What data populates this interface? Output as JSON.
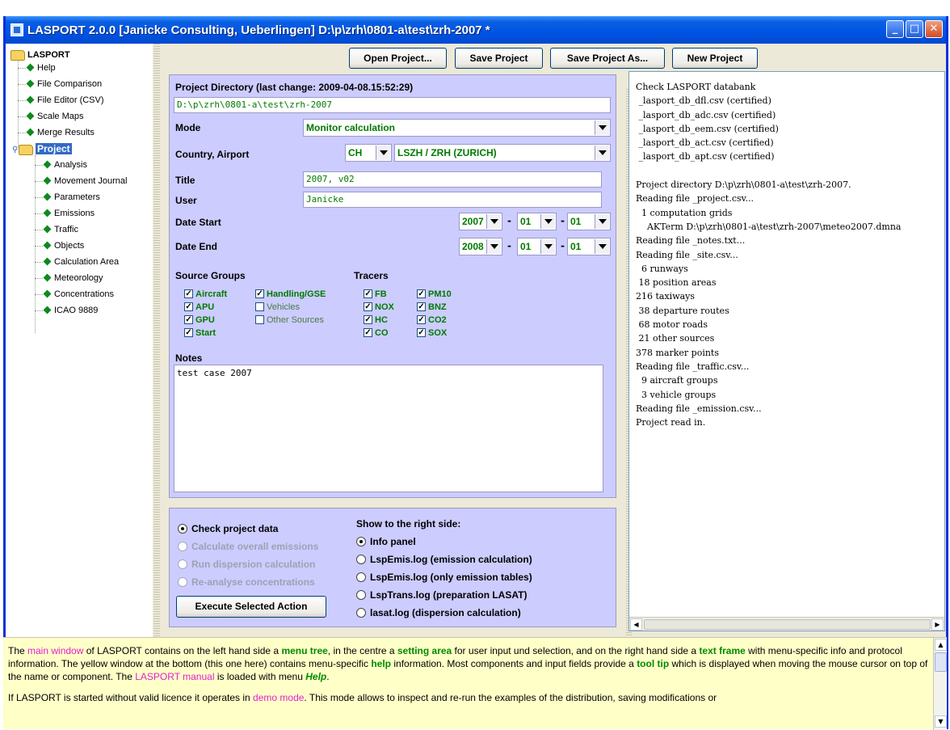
{
  "window": {
    "title": "LASPORT 2.0.0 [Janicke Consulting, Ueberlingen] D:\\p\\zrh\\0801-a\\test\\zrh-2007 *"
  },
  "tree": {
    "root": "LASPORT",
    "items": [
      "Help",
      "File Comparison",
      "File Editor (CSV)",
      "Scale Maps",
      "Merge Results"
    ],
    "project": "Project",
    "project_items": [
      "Analysis",
      "Movement Journal",
      "Parameters",
      "Emissions",
      "Traffic",
      "Objects",
      "Calculation Area",
      "Meteorology",
      "Concentrations",
      "ICAO 9889"
    ]
  },
  "toolbar": {
    "open": "Open Project...",
    "save": "Save Project",
    "save_as": "Save Project As...",
    "new": "New Project"
  },
  "project": {
    "dir_label": "Project Directory (last change: 2009-04-08.15:52:29)",
    "dir_value": "D:\\p\\zrh\\0801-a\\test\\zrh-2007",
    "mode_label": "Mode",
    "mode_value": "Monitor calculation",
    "country_label": "Country, Airport",
    "country_value": "CH",
    "airport_value": "LSZH / ZRH (ZURICH)",
    "title_label": "Title",
    "title_value": "2007, v02",
    "user_label": "User",
    "user_value": "Janicke",
    "date_start_label": "Date Start",
    "date_start": {
      "year": "2007",
      "month": "01",
      "day": "01"
    },
    "date_end_label": "Date End",
    "date_end": {
      "year": "2008",
      "month": "01",
      "day": "01"
    },
    "date_sep": "-",
    "source_groups_label": "Source Groups",
    "tracers_label": "Tracers",
    "source_groups": [
      {
        "label": "Aircraft",
        "checked": true
      },
      {
        "label": "APU",
        "checked": true
      },
      {
        "label": "GPU",
        "checked": true
      },
      {
        "label": "Start",
        "checked": true
      },
      {
        "label": "Handling/GSE",
        "checked": true
      },
      {
        "label": "Vehicles",
        "checked": false
      },
      {
        "label": "Other Sources",
        "checked": false
      }
    ],
    "tracers": [
      {
        "label": "FB",
        "checked": true
      },
      {
        "label": "NOX",
        "checked": true
      },
      {
        "label": "HC",
        "checked": true
      },
      {
        "label": "CO",
        "checked": true
      },
      {
        "label": "PM10",
        "checked": true
      },
      {
        "label": "BNZ",
        "checked": true
      },
      {
        "label": "CO2",
        "checked": true
      },
      {
        "label": "SOX",
        "checked": true
      }
    ],
    "notes_label": "Notes",
    "notes_value": "test case 2007"
  },
  "actions": {
    "items": [
      "Check project data",
      "Calculate overall emissions",
      "Run dispersion calculation",
      "Re-analyse concentrations"
    ],
    "selected": 0,
    "execute": "Execute Selected Action",
    "show_label": "Show to the right side:",
    "show_items": [
      "Info panel",
      "LspEmis.log (emission calculation)",
      "LspEmis.log (only emission tables)",
      "LspTrans.log (preparation LASAT)",
      "lasat.log (dispersion calculation)"
    ],
    "show_selected": 0
  },
  "info_lines": [
    "Check LASPORT databank",
    " _lasport_db_dfl.csv (certified)",
    " _lasport_db_adc.csv (certified)",
    " _lasport_db_eem.csv (certified)",
    " _lasport_db_act.csv (certified)",
    " _lasport_db_apt.csv (certified)",
    "",
    "Project directory D:\\p\\zrh\\0801-a\\test\\zrh-2007.",
    "Reading file _project.csv...",
    "  1 computation grids",
    "    AKTerm D:\\p\\zrh\\0801-a\\test\\zrh-2007\\meteo2007.dmna",
    "Reading file _notes.txt...",
    "Reading file _site.csv...",
    "  6 runways",
    " 18 position areas",
    "216 taxiways",
    " 38 departure routes",
    " 68 motor roads",
    " 21 other sources",
    "378 marker points",
    "Reading file _traffic.csv...",
    "  9 aircraft groups",
    "  3 vehicle groups",
    "Reading file _emission.csv...",
    "Project read in."
  ],
  "help": {
    "p1": [
      "The ",
      "main window",
      " of LASPORT contains on the left hand side a ",
      "menu tree",
      ", in the centre a ",
      "setting area",
      " for user input und selection, and on the right hand side a ",
      "text frame",
      " with menu-specific info and protocol information. The yellow window at the bottom (this one here) contains menu-specific ",
      "help",
      " information. Most components and input fields provide a ",
      "tool tip",
      " which is displayed when moving the mouse cursor on top of the name or component. The ",
      "LASPORT manual",
      " is loaded with menu ",
      "Help",
      "."
    ],
    "p2": [
      "If LASPORT is started without valid licence it operates in ",
      "demo mode",
      ". This mode allows to inspect and re-run the examples of the distribution, saving modifications or"
    ]
  }
}
